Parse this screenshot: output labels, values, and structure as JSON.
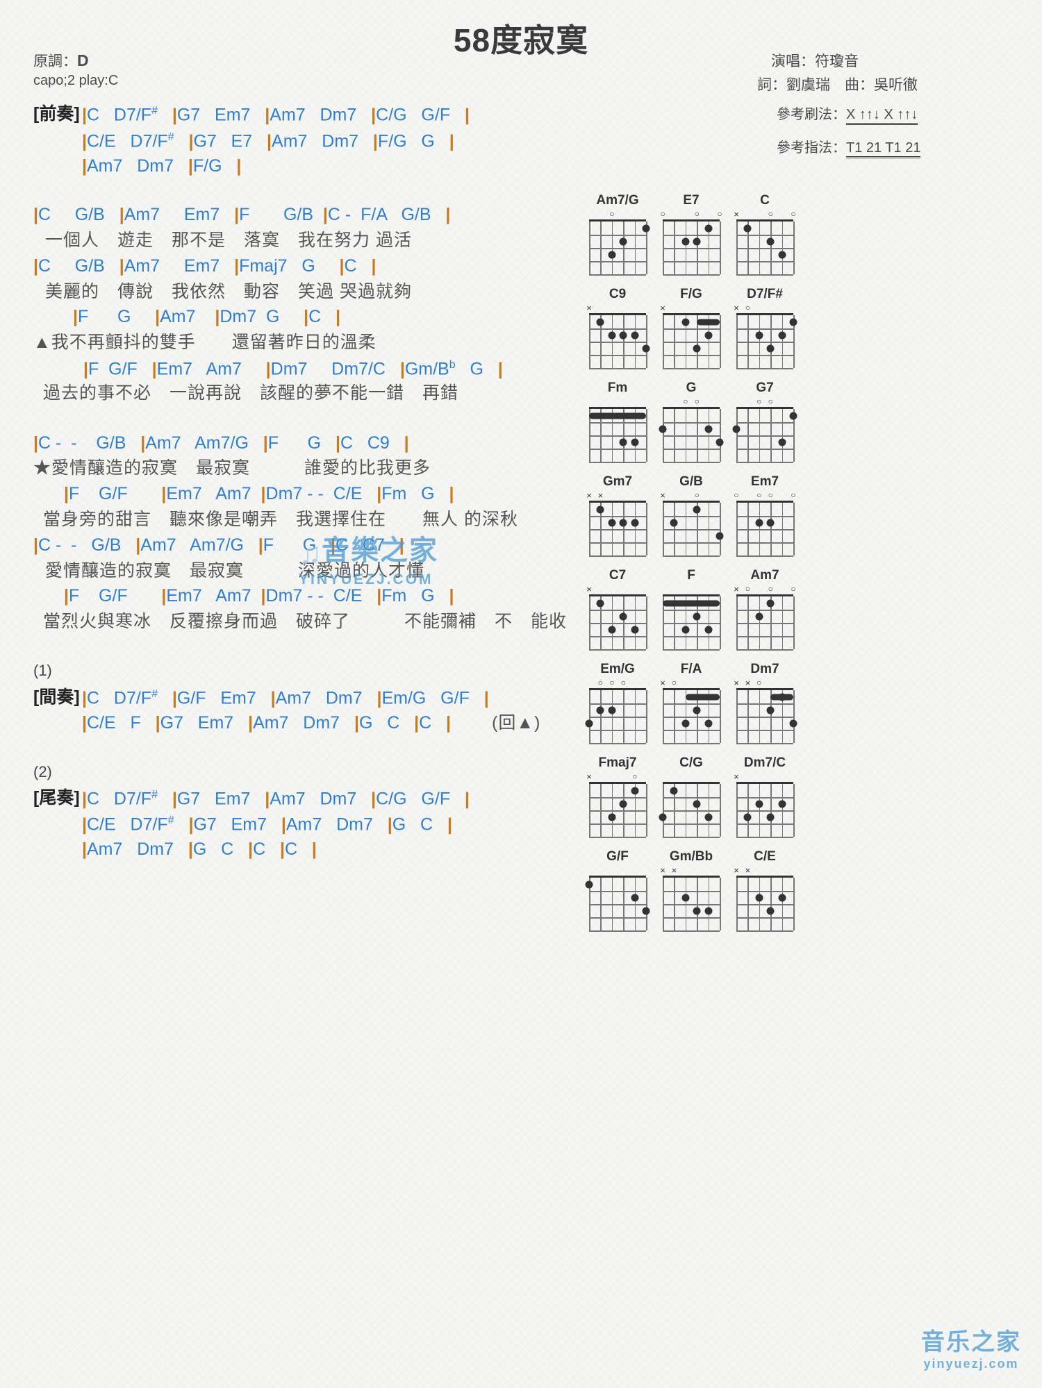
{
  "header": {
    "title": "58度寂寞",
    "key_label": "原調：",
    "key_value": "D",
    "capo": "capo;2 play:C",
    "singer": "演唱：符瓊音",
    "writer": "詞：劉虞瑞　曲：吳听徹",
    "strum_label": "參考刷法：",
    "strum_pattern": "X ↑↑↓ X ↑↑↓",
    "finger_label": "參考指法：",
    "finger_pattern": "T1 21 T1 21"
  },
  "sections": {
    "intro_tag": "[前奏]",
    "interlude_tag": "[間奏]",
    "outro_tag": "[尾奏]",
    "mark_1": "(1)",
    "mark_2": "(2)",
    "repeat_note": "(回▲)"
  },
  "lines": [
    {
      "id": "l1",
      "type": "chord",
      "text": "|C   D7/F#   |G7   Em7   |Am7   Dm7   |C/G   G/F   |"
    },
    {
      "id": "l2",
      "type": "chord",
      "text": "|C/E   D7/F#   |G7   E7   |Am7   Dm7   |F/G   G   |"
    },
    {
      "id": "l3",
      "type": "chord",
      "text": "|Am7   Dm7   |F/G   |"
    },
    {
      "id": "l4",
      "type": "chord",
      "text": "|C     G/B   |Am7     Em7   |F       G/B  |C -  F/A   G/B   |"
    },
    {
      "id": "l5",
      "type": "lyric",
      "text": "一個人　遊走　那不是　落寞　我在努力 過活"
    },
    {
      "id": "l6",
      "type": "chord",
      "text": "|C     G/B   |Am7     Em7   |Fmaj7   G     |C   |"
    },
    {
      "id": "l7",
      "type": "lyric",
      "text": "美麗的　傳說　我依然　動容　笑過 哭過就夠"
    },
    {
      "id": "l8",
      "type": "chord",
      "text": "|F      G     |Am7    |Dm7  G     |C   |"
    },
    {
      "id": "l9",
      "type": "lyric",
      "text": "▲我不再顫抖的雙手　　還留著昨日的溫柔"
    },
    {
      "id": "l10",
      "type": "chord",
      "text": "|F  G/F   |Em7   Am7     |Dm7     Dm7/C   |Gm/Bb   G   |"
    },
    {
      "id": "l11",
      "type": "lyric",
      "text": "過去的事不必　一說再說　該醒的夢不能一錯　再錯"
    },
    {
      "id": "l12",
      "type": "chord",
      "text": "|C -  -    G/B   |Am7   Am7/G   |F      G   |C   C9   |"
    },
    {
      "id": "l13",
      "type": "lyric",
      "text": "★愛情釀造的寂寞　最寂寞　　　誰愛的比我更多"
    },
    {
      "id": "l14",
      "type": "chord",
      "text": "|F    G/F       |Em7   Am7  |Dm7 - -  C/E   |Fm   G   |"
    },
    {
      "id": "l15",
      "type": "lyric",
      "text": "當身旁的甜言　聽來像是嘲弄　我選擇住在　　無人 的深秋"
    },
    {
      "id": "l16",
      "type": "chord",
      "text": "|C -  -   G/B   |Am7   Am7/G   |F      G   |C   C7   |"
    },
    {
      "id": "l17",
      "type": "lyric",
      "text": "愛情釀造的寂寞　最寂寞　　　深愛過的人才懂"
    },
    {
      "id": "l18",
      "type": "chord",
      "text": "|F    G/F       |Em7   Am7  |Dm7 - -  C/E   |Fm   G   |"
    },
    {
      "id": "l19",
      "type": "lyric",
      "text": "當烈火與寒冰　反覆擦身而過　破碎了　　　不能彌補　不　能收"
    },
    {
      "id": "l20",
      "type": "chord",
      "text": "|C   D7/F#   |G/F   Em7   |Am7   Dm7   |Em/G   G/F   |"
    },
    {
      "id": "l21",
      "type": "chord",
      "text": "|C/E   F   |G7   Em7   |Am7   Dm7   |G   C   |C   |"
    },
    {
      "id": "l22",
      "type": "chord",
      "text": "|C   D7/F#   |G7   Em7   |Am7   Dm7   |C/G   G/F   |"
    },
    {
      "id": "l23",
      "type": "chord",
      "text": "|C/E   D7/F#   |G7   Em7   |Am7   Dm7   |G   C   |"
    },
    {
      "id": "l24",
      "type": "chord",
      "text": "|Am7   Dm7   |G   C   |C   |C   |"
    }
  ],
  "chord_diagrams": [
    {
      "name": "Am7/G",
      "marks": [
        [
          "",
          0
        ],
        [
          "",
          1
        ],
        [
          "o",
          2
        ],
        [
          "",
          3
        ],
        [
          "",
          4
        ],
        [
          "",
          5
        ]
      ],
      "dots": [
        [
          1,
          5
        ],
        [
          2,
          3
        ],
        [
          3,
          2
        ]
      ],
      "barre": null
    },
    {
      "name": "E7",
      "marks": [
        [
          "o",
          0
        ],
        [
          "",
          1
        ],
        [
          "",
          2
        ],
        [
          "o",
          3
        ],
        [
          "",
          4
        ],
        [
          "o",
          5
        ]
      ],
      "dots": [
        [
          1,
          4
        ],
        [
          2,
          2
        ],
        [
          2,
          3
        ]
      ],
      "barre": null
    },
    {
      "name": "C",
      "marks": [
        [
          "x",
          0
        ],
        [
          "",
          1
        ],
        [
          "",
          2
        ],
        [
          "o",
          3
        ],
        [
          "",
          4
        ],
        [
          "o",
          5
        ]
      ],
      "dots": [
        [
          1,
          1
        ],
        [
          2,
          3
        ],
        [
          3,
          4
        ]
      ],
      "barre": null
    },
    {
      "name": "C9",
      "marks": [
        [
          "x",
          0
        ],
        [
          "",
          1
        ],
        [
          "",
          2
        ],
        [
          "",
          3
        ],
        [
          "",
          4
        ],
        [
          "",
          5
        ]
      ],
      "dots": [
        [
          1,
          1
        ],
        [
          2,
          2
        ],
        [
          2,
          3
        ],
        [
          2,
          4
        ],
        [
          3,
          5
        ]
      ],
      "barre": null
    },
    {
      "name": "F/G",
      "marks": [
        [
          "x",
          0
        ],
        [
          "",
          1
        ],
        [
          "",
          2
        ],
        [
          "",
          3
        ],
        [
          "",
          4
        ],
        [
          "",
          5
        ]
      ],
      "dots": [
        [
          1,
          2
        ],
        [
          2,
          4
        ],
        [
          3,
          3
        ]
      ],
      "barre": [
        1,
        3,
        5
      ]
    },
    {
      "name": "D7/F#",
      "marks": [
        [
          "x",
          0
        ],
        [
          "o",
          1
        ],
        [
          "",
          2
        ],
        [
          "",
          3
        ],
        [
          "",
          4
        ],
        [
          "",
          5
        ]
      ],
      "dots": [
        [
          1,
          5
        ],
        [
          2,
          2
        ],
        [
          2,
          4
        ],
        [
          3,
          3
        ]
      ],
      "barre": null
    },
    {
      "name": "Fm",
      "marks": [
        [
          "",
          0
        ],
        [
          "",
          1
        ],
        [
          "",
          2
        ],
        [
          "",
          3
        ],
        [
          "",
          4
        ],
        [
          "",
          5
        ]
      ],
      "dots": [
        [
          3,
          3
        ],
        [
          3,
          4
        ]
      ],
      "barre": [
        1,
        0,
        5
      ]
    },
    {
      "name": "G",
      "marks": [
        [
          "",
          0
        ],
        [
          "",
          1
        ],
        [
          "o",
          2
        ],
        [
          "o",
          3
        ],
        [
          "",
          4
        ],
        [
          "",
          5
        ]
      ],
      "dots": [
        [
          2,
          0
        ],
        [
          2,
          4
        ],
        [
          3,
          5
        ]
      ],
      "barre": null
    },
    {
      "name": "G7",
      "marks": [
        [
          "",
          0
        ],
        [
          "",
          1
        ],
        [
          "o",
          2
        ],
        [
          "o",
          3
        ],
        [
          "",
          4
        ],
        [
          "",
          5
        ]
      ],
      "dots": [
        [
          1,
          5
        ],
        [
          2,
          0
        ],
        [
          3,
          4
        ]
      ],
      "barre": null
    },
    {
      "name": "Gm7",
      "marks": [
        [
          "x",
          0
        ],
        [
          "x",
          1
        ],
        [
          "",
          2
        ],
        [
          "",
          3
        ],
        [
          "",
          4
        ],
        [
          "",
          5
        ]
      ],
      "dots": [
        [
          1,
          1
        ],
        [
          2,
          2
        ],
        [
          2,
          3
        ],
        [
          2,
          4
        ]
      ],
      "barre": null
    },
    {
      "name": "G/B",
      "marks": [
        [
          "x",
          0
        ],
        [
          "",
          1
        ],
        [
          "",
          2
        ],
        [
          "o",
          3
        ],
        [
          "",
          4
        ],
        [
          "",
          5
        ]
      ],
      "dots": [
        [
          1,
          3
        ],
        [
          2,
          1
        ],
        [
          3,
          5
        ]
      ],
      "barre": null
    },
    {
      "name": "Em7",
      "marks": [
        [
          "o",
          0
        ],
        [
          "",
          1
        ],
        [
          "o",
          2
        ],
        [
          "o",
          3
        ],
        [
          "",
          4
        ],
        [
          "o",
          5
        ]
      ],
      "dots": [
        [
          2,
          2
        ],
        [
          2,
          3
        ]
      ],
      "barre": null
    },
    {
      "name": "C7",
      "marks": [
        [
          "x",
          0
        ],
        [
          "",
          1
        ],
        [
          "",
          2
        ],
        [
          "",
          3
        ],
        [
          "",
          4
        ],
        [
          "",
          5
        ]
      ],
      "dots": [
        [
          1,
          1
        ],
        [
          2,
          3
        ],
        [
          3,
          2
        ],
        [
          3,
          4
        ]
      ],
      "barre": null
    },
    {
      "name": "F",
      "marks": [
        [
          "",
          0
        ],
        [
          "",
          1
        ],
        [
          "",
          2
        ],
        [
          "",
          3
        ],
        [
          "",
          4
        ],
        [
          "",
          5
        ]
      ],
      "dots": [
        [
          2,
          3
        ],
        [
          3,
          2
        ],
        [
          3,
          4
        ]
      ],
      "barre": [
        1,
        0,
        5
      ]
    },
    {
      "name": "Am7",
      "marks": [
        [
          "x",
          0
        ],
        [
          "o",
          1
        ],
        [
          "",
          2
        ],
        [
          "o",
          3
        ],
        [
          "",
          4
        ],
        [
          "o",
          5
        ]
      ],
      "dots": [
        [
          1,
          3
        ],
        [
          2,
          2
        ]
      ],
      "barre": null
    },
    {
      "name": "Em/G",
      "marks": [
        [
          "",
          0
        ],
        [
          "o",
          1
        ],
        [
          "o",
          2
        ],
        [
          "o",
          3
        ],
        [
          "",
          4
        ],
        [
          "",
          5
        ]
      ],
      "dots": [
        [
          2,
          1
        ],
        [
          2,
          2
        ],
        [
          3,
          0
        ]
      ],
      "barre": null
    },
    {
      "name": "F/A",
      "marks": [
        [
          "x",
          0
        ],
        [
          "o",
          1
        ],
        [
          "",
          2
        ],
        [
          "",
          3
        ],
        [
          "",
          4
        ],
        [
          "",
          5
        ]
      ],
      "dots": [
        [
          2,
          3
        ],
        [
          3,
          2
        ],
        [
          3,
          4
        ]
      ],
      "barre": [
        1,
        2,
        5
      ]
    },
    {
      "name": "Dm7",
      "marks": [
        [
          "x",
          0
        ],
        [
          "x",
          1
        ],
        [
          "o",
          2
        ],
        [
          "",
          3
        ],
        [
          "",
          4
        ],
        [
          "",
          5
        ]
      ],
      "dots": [
        [
          1,
          4
        ],
        [
          2,
          3
        ],
        [
          3,
          5
        ]
      ],
      "barre": [
        1,
        3,
        5
      ]
    },
    {
      "name": "Fmaj7",
      "marks": [
        [
          "x",
          0
        ],
        [
          "",
          1
        ],
        [
          "",
          2
        ],
        [
          "",
          3
        ],
        [
          "o",
          4
        ],
        [
          "",
          5
        ]
      ],
      "dots": [
        [
          1,
          4
        ],
        [
          2,
          3
        ],
        [
          3,
          2
        ]
      ],
      "barre": null
    },
    {
      "name": "C/G",
      "marks": [
        [
          "",
          0
        ],
        [
          "",
          1
        ],
        [
          "",
          2
        ],
        [
          "",
          3
        ],
        [
          "",
          4
        ],
        [
          "",
          5
        ]
      ],
      "dots": [
        [
          1,
          1
        ],
        [
          2,
          3
        ],
        [
          3,
          0
        ],
        [
          3,
          4
        ]
      ],
      "barre": null
    },
    {
      "name": "Dm7/C",
      "marks": [
        [
          "x",
          0
        ],
        [
          "",
          1
        ],
        [
          "",
          2
        ],
        [
          "",
          3
        ],
        [
          "",
          4
        ],
        [
          "",
          5
        ]
      ],
      "dots": [
        [
          2,
          2
        ],
        [
          2,
          4
        ],
        [
          3,
          1
        ],
        [
          3,
          3
        ]
      ],
      "barre": null
    },
    {
      "name": "G/F",
      "marks": [
        [
          "",
          0
        ],
        [
          "",
          1
        ],
        [
          "",
          2
        ],
        [
          "",
          3
        ],
        [
          "",
          4
        ],
        [
          "",
          5
        ]
      ],
      "dots": [
        [
          1,
          0
        ],
        [
          2,
          4
        ],
        [
          3,
          5
        ]
      ],
      "barre": null
    },
    {
      "name": "Gm/Bb",
      "marks": [
        [
          "x",
          0
        ],
        [
          "x",
          1
        ],
        [
          "",
          2
        ],
        [
          "",
          3
        ],
        [
          "",
          4
        ],
        [
          "",
          5
        ]
      ],
      "dots": [
        [
          2,
          2
        ],
        [
          3,
          3
        ],
        [
          3,
          4
        ]
      ],
      "barre": null
    },
    {
      "name": "C/E",
      "marks": [
        [
          "x",
          0
        ],
        [
          "x",
          1
        ],
        [
          "",
          2
        ],
        [
          "",
          3
        ],
        [
          "",
          4
        ],
        [
          "",
          5
        ]
      ],
      "dots": [
        [
          2,
          2
        ],
        [
          2,
          4
        ],
        [
          3,
          3
        ]
      ],
      "barre": null
    }
  ],
  "watermark": {
    "center_text": "音樂之家",
    "center_sub": "YINYUEZJ.COM",
    "bottom_text": "音乐之家",
    "bottom_sub": "yinyuezj.com"
  },
  "colors": {
    "chord_blue": "#2f7fd0",
    "barline_orange": "#c87a1e",
    "lyric_gray": "#555555",
    "watermark_blue": "#4a9ad4",
    "page_bg": "#f5f5f3"
  }
}
